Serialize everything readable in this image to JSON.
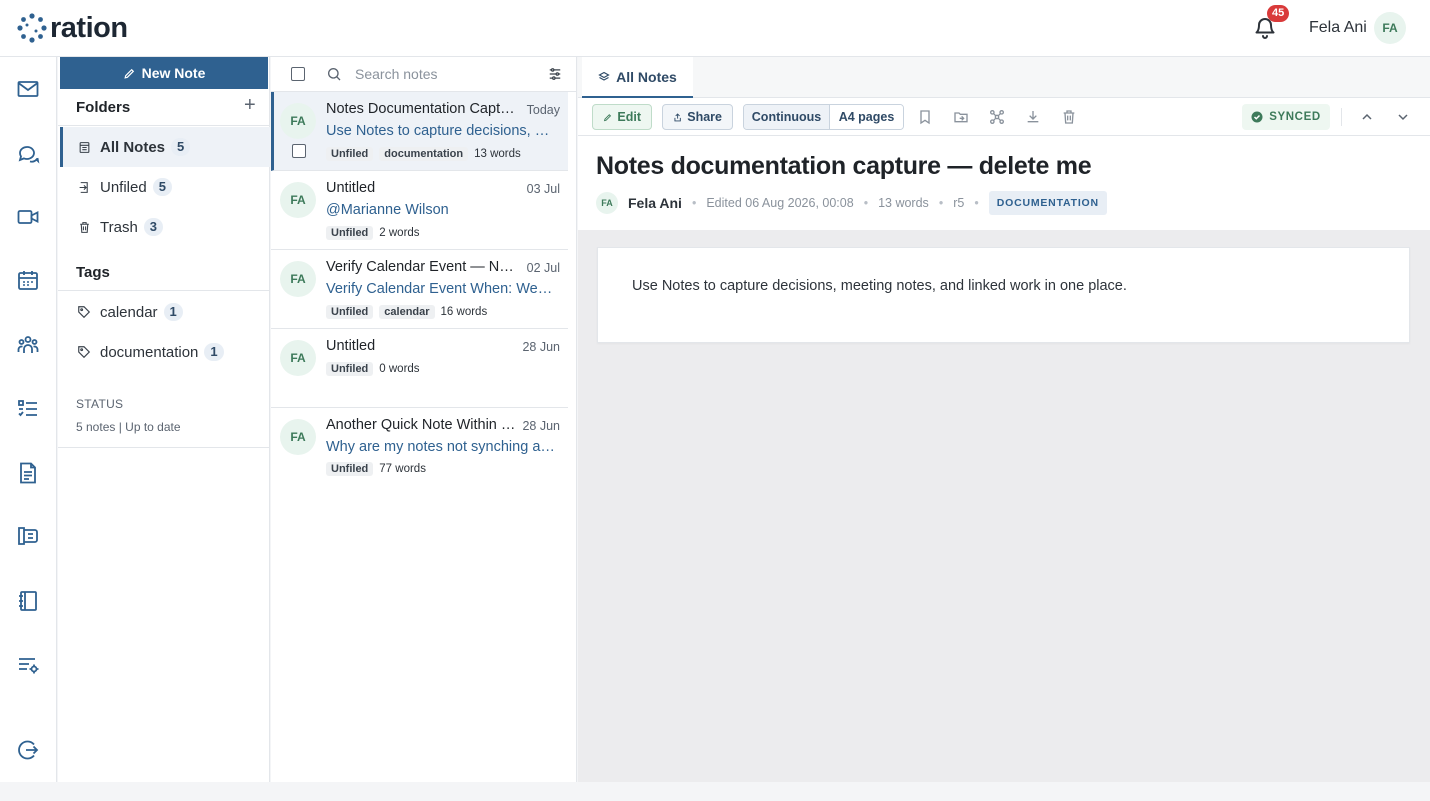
{
  "app": {
    "logo_text": "ration",
    "notification_count": "45",
    "user_name": "Fela Ani",
    "user_initials": "FA"
  },
  "rail": {
    "icons": [
      "mail-icon",
      "chat-icon",
      "video-icon",
      "calendar-icon",
      "people-icon",
      "tasks-icon",
      "document-icon",
      "book-open-icon",
      "notebook-icon",
      "settings-list-icon",
      "logout-icon"
    ]
  },
  "sidebar": {
    "new_note_label": "New Note",
    "folders_title": "Folders",
    "folders": [
      {
        "label": "All Notes",
        "count": "5",
        "icon": "notes-icon",
        "active": true
      },
      {
        "label": "Unfiled",
        "count": "5",
        "icon": "unfiled-icon",
        "active": false
      },
      {
        "label": "Trash",
        "count": "3",
        "icon": "trash-icon",
        "active": false
      }
    ],
    "tags_title": "Tags",
    "tags": [
      {
        "label": "calendar",
        "count": "1",
        "icon": "tag-icon"
      },
      {
        "label": "documentation",
        "count": "1",
        "icon": "tag-icon"
      }
    ],
    "status_title": "STATUS",
    "status_text": "5 notes | Up to date"
  },
  "list": {
    "search_placeholder": "Search notes",
    "notes": [
      {
        "initials": "FA",
        "title": "Notes Documentation Capture — delete me",
        "date": "Today",
        "preview": "Use Notes to capture decisions, meeting notes, and linked work in one place.",
        "folder": "Unfiled",
        "tags": [
          "documentation"
        ],
        "words": "13 words",
        "active": true
      },
      {
        "initials": "FA",
        "title": "Untitled",
        "date": "03 Jul",
        "preview": "@Marianne Wilson",
        "folder": "Unfiled",
        "tags": [],
        "words": "2 words",
        "active": false
      },
      {
        "initials": "FA",
        "title": "Verify Calendar Event — Notes",
        "date": "02 Jul",
        "preview": "Verify Calendar Event When: Wednesday",
        "folder": "Unfiled",
        "tags": [
          "calendar"
        ],
        "words": "16 words",
        "active": false
      },
      {
        "initials": "FA",
        "title": "Untitled",
        "date": "28 Jun",
        "preview": "",
        "folder": "Unfiled",
        "tags": [],
        "words": "0 words",
        "active": false
      },
      {
        "initials": "FA",
        "title": "Another Quick Note Within Notes",
        "date": "28 Jun",
        "preview": "Why are my notes not synching automatically?",
        "folder": "Unfiled",
        "tags": [],
        "words": "77 words",
        "active": false
      }
    ]
  },
  "editor": {
    "tab_label": "All Notes",
    "edit_label": "Edit",
    "share_label": "Share",
    "view_continuous": "Continuous",
    "view_a4": "A4 pages",
    "synced_label": "SYNCED",
    "doc_title": "Notes documentation capture — delete me",
    "author_initials": "FA",
    "author": "Fela Ani",
    "edited": "Edited 06 Aug 2026, 00:08",
    "words": "13 words",
    "revision": "r5",
    "tag": "DOCUMENTATION",
    "body_text": "Use Notes to capture decisions, meeting notes, and linked work in one place."
  },
  "colors": {
    "primary": "#2f6190",
    "badge": "#d93a3a",
    "synced": "#3d7a5a",
    "link": "#2f6190"
  }
}
